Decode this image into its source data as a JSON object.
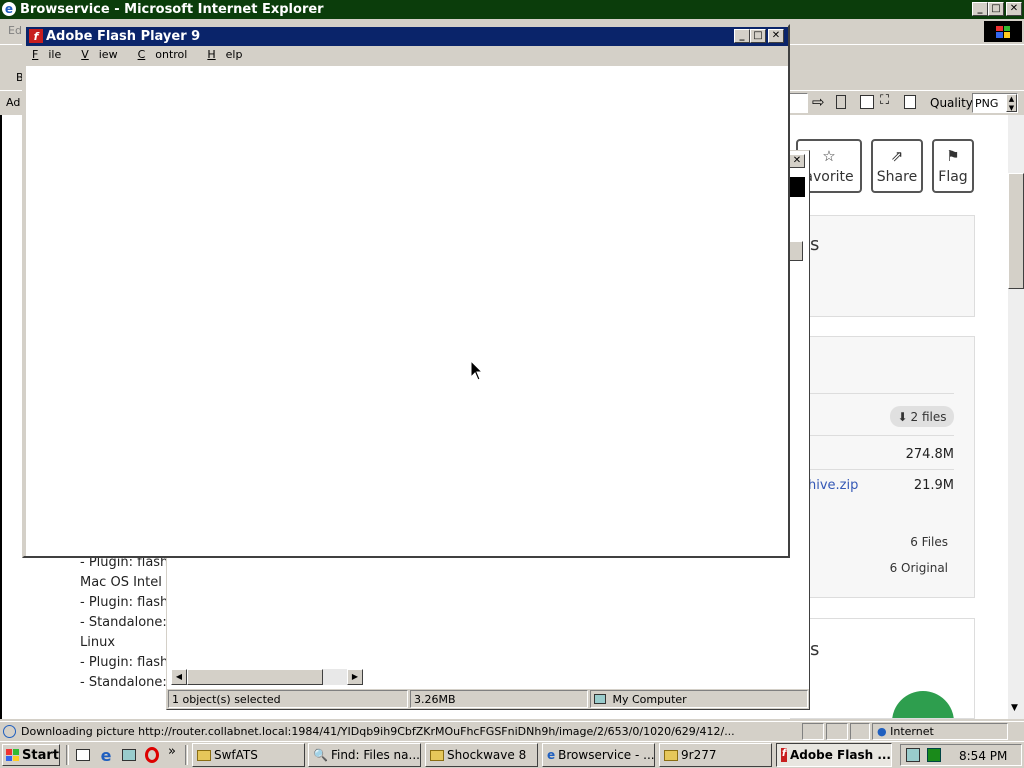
{
  "ie_window": {
    "title": "Browservice - Microsoft Internet Explorer",
    "min": "_",
    "restore": "□",
    "close": "✕",
    "address_label": "Ad",
    "quality_label": "Quality",
    "quality_value": "PNG",
    "status_text": "Downloading picture http://router.collabnet.local:1984/41/YIDqb9ih9CbfZKrMOuFhcFGSFniDNh9h/image/2/653/0/1020/629/412/...",
    "zone": "Internet",
    "menu_partial": "Ed",
    "toolbar_partial": "B"
  },
  "page": {
    "buttons": [
      {
        "label": "avorite",
        "icon": "☆"
      },
      {
        "label": "Share",
        "icon": "⇗"
      },
      {
        "label": "Flag",
        "icon": "⚑"
      }
    ],
    "heading_s": "s",
    "heading_s2": "s",
    "files_badge": "2 files",
    "size1": "274.8M",
    "archive_link": "hive.zip",
    "size2": "21.9M",
    "files_count": "6 Files",
    "original_count": "6 Original",
    "platform_list": [
      "- Plugin: flash",
      "Mac OS Intel",
      "- Plugin: flash",
      "- Standalone:",
      "Linux",
      "- Plugin: flash",
      "- Standalone:"
    ]
  },
  "explorer": {
    "status_selected": "1 object(s) selected",
    "status_size": "3.26MB",
    "status_location": "My Computer"
  },
  "flash_window": {
    "title": "Adobe Flash Player 9",
    "menu": [
      {
        "label": "File",
        "key": "F",
        "rest": "ile"
      },
      {
        "label": "View",
        "key": "V",
        "rest": "iew"
      },
      {
        "label": "Control",
        "key": "C",
        "rest": "ontrol"
      },
      {
        "label": "Help",
        "key": "H",
        "rest": "elp"
      }
    ]
  },
  "taskbar": {
    "start": "Start",
    "chevron": "»",
    "tasks": [
      "SwfATS",
      "Find: Files na...",
      "Shockwave 8",
      "Browservice - ...",
      "9r277",
      "Adobe Flash ..."
    ],
    "clock": "8:54 PM"
  },
  "colors": {
    "title_active": "#0a246a",
    "title_inactive_ie": "#0b3d0b",
    "face": "#d4d0c8",
    "flash_red": "#c81e1e",
    "link_blue": "#3458b6",
    "badge_gray": "#e0e0e0"
  },
  "icons": [
    "ie-icon",
    "flash-icon",
    "folder-icon",
    "find-icon",
    "computer-icon",
    "globe-icon",
    "start-windows-icon",
    "star-icon",
    "share-icon",
    "flag-icon",
    "download-icon",
    "cursor-icon"
  ]
}
